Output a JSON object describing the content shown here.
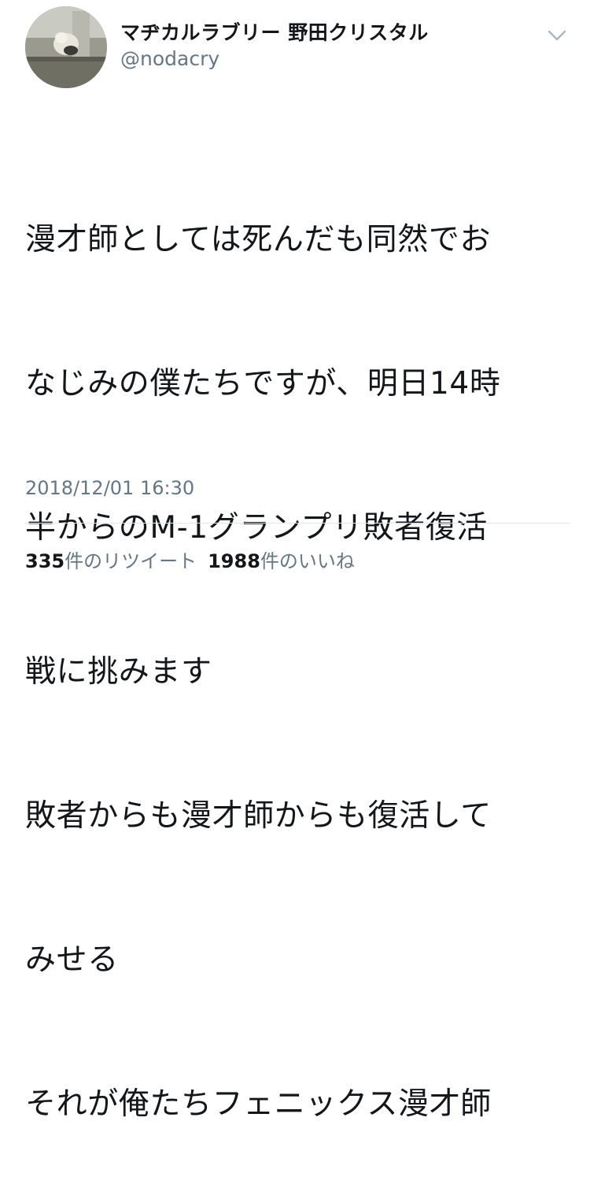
{
  "author": {
    "display_name": "マヂカルラブリー 野田クリスタル",
    "handle": "@nodacry",
    "avatar_icon": "profile-photo-avatar"
  },
  "tweet": {
    "text_lines": [
      "漫才師としては死んだも同然でお",
      "なじみの僕たちですが、明日14時",
      "半からのM-1グランプリ敗者復活",
      "戦に挑みます",
      "敗者からも漫才師からも復活して",
      "みせる",
      "それが俺たちフェニックス漫才師"
    ],
    "timestamp": "2018/12/01 16:30"
  },
  "stats": {
    "retweets_count": "335",
    "retweets_label": "件のリツイート",
    "likes_count": "1988",
    "likes_label": "件のいいね"
  },
  "icons": {
    "menu": "chevron-down-icon"
  },
  "colors": {
    "text_primary": "#14171a",
    "text_secondary": "#657786",
    "divider": "#e1e8ed"
  }
}
